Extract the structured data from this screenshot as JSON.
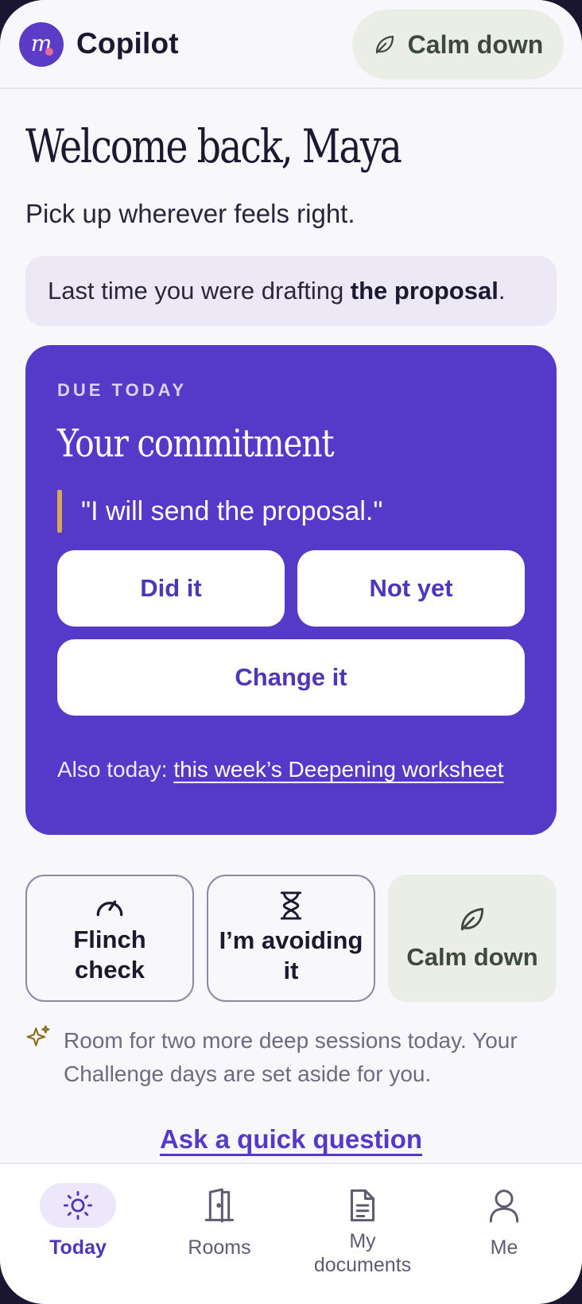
{
  "header": {
    "logo_letter": "m",
    "app_title": "Copilot",
    "calm_button_label": "Calm down"
  },
  "welcome": {
    "title": "Welcome back, Maya",
    "subtitle": "Pick up wherever feels right."
  },
  "last_time": {
    "prefix": "Last time you were drafting ",
    "highlight": "the proposal",
    "suffix": "."
  },
  "commitment_card": {
    "eyebrow": "DUE TODAY",
    "title": "Your commitment",
    "quote": "\"I will send the proposal.\"",
    "did_it_label": "Did it",
    "not_yet_label": "Not yet",
    "change_it_label": "Change it",
    "also_prefix": "Also today: ",
    "also_link": "this week’s Deepening worksheet"
  },
  "tiles": {
    "flinch_line1": "Flinch",
    "flinch_line2": "check",
    "avoid_line1": "I’m avoiding",
    "avoid_line2": "it",
    "calm_label": "Calm down"
  },
  "note": {
    "text": "Room for two more deep sessions today. Your Challenge days are set aside for you."
  },
  "ask_link": "Ask a quick question",
  "nav": {
    "today": "Today",
    "rooms": "Rooms",
    "docs_line1": "My",
    "docs_line2": "documents",
    "me": "Me"
  },
  "colors": {
    "brand": "#5539c8",
    "accent_bar": "#d8a65a",
    "calm_bg": "#eaeee6",
    "background": "#f8f7fb"
  },
  "icons": {
    "calm": "leaf-icon",
    "flinch": "gauge-icon",
    "avoid": "hourglass-icon",
    "note": "sparkle-icon",
    "today": "sun-icon",
    "rooms": "door-icon",
    "docs": "document-icon",
    "me": "person-icon"
  }
}
